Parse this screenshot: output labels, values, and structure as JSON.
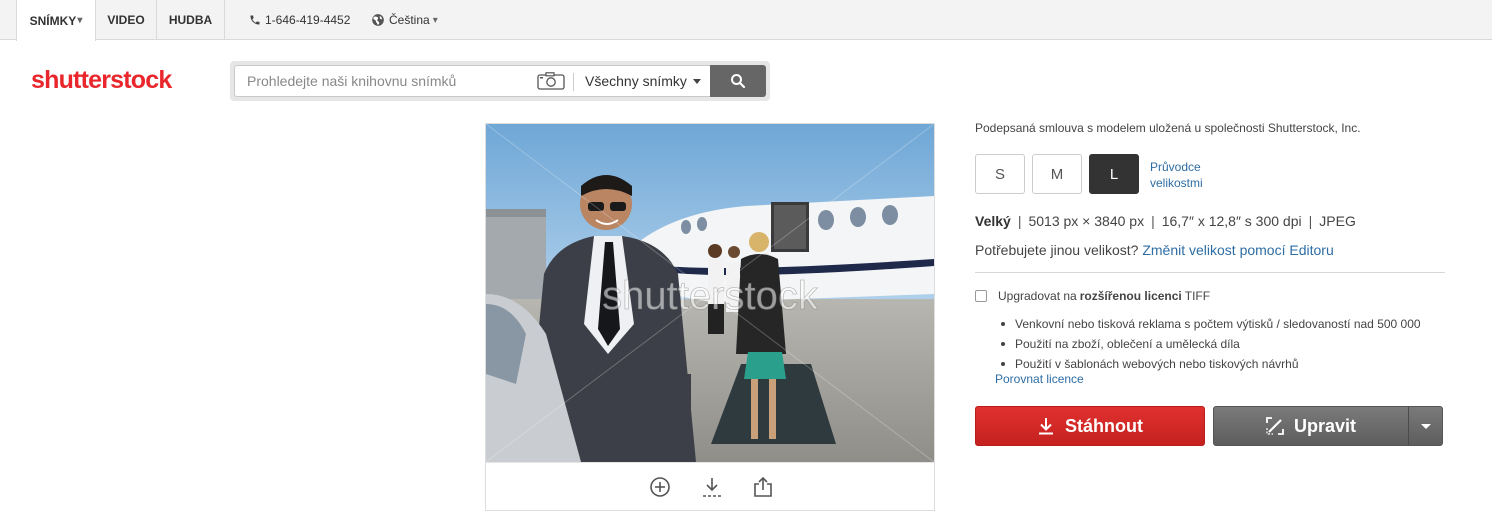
{
  "topnav": {
    "tabs": [
      {
        "label": "SNÍMKY",
        "caret": "▾"
      },
      {
        "label": "VIDEO"
      },
      {
        "label": "HUDBA"
      }
    ],
    "phone": "1-646-419-4452",
    "language": "Čeština",
    "language_caret": "▾"
  },
  "header": {
    "logo": "shutterstock",
    "search": {
      "placeholder": "Prohledejte naši knihovnu snímků",
      "filter_label": "Všechny snímky"
    }
  },
  "photo": {
    "watermark": "shutterstock",
    "actions": [
      "zoom-icon",
      "download-icon",
      "share-icon"
    ]
  },
  "details": {
    "release_text": "Podepsaná smlouva s modelem uložená u společnosti Shutterstock, Inc.",
    "sizes": [
      "S",
      "M",
      "L"
    ],
    "selected_size": "L",
    "size_guide": "Průvodce velikostmi",
    "size_name": "Velký",
    "pixels": "5013 px × 3840 px",
    "print": "16,7″ x 12,8″ s 300 dpi",
    "format": "JPEG",
    "need_size_text": "Potřebujete jinou velikost?",
    "need_size_link": "Změnit velikost pomocí Editoru",
    "upgrade": {
      "prefix": "Upgradovat na",
      "bold": "rozšířenou licenci",
      "suffix": "TIFF",
      "checked": false
    },
    "benefits": [
      "Venkovní nebo tisková reklama s počtem výtisků / sledovaností nad 500 000",
      "Použití na zboží, oblečení a umělecká díla",
      "Použití v šablonách webových nebo tiskových návrhů"
    ],
    "compare_link": "Porovnat licence",
    "download_label": "Stáhnout",
    "edit_label": "Upravit"
  },
  "colors": {
    "brand_red": "#e8262b",
    "download_red": "#d12a28",
    "edit_gray": "#6b6b6b",
    "link_blue": "#2e6da4"
  }
}
